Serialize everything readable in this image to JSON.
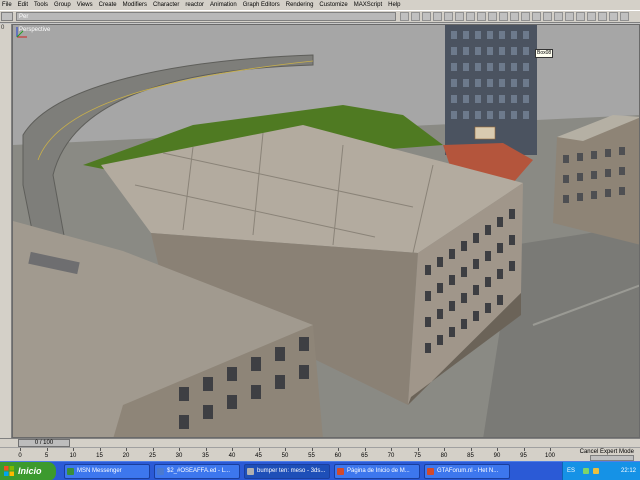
{
  "menu": {
    "items": [
      "File",
      "Edit",
      "Tools",
      "Group",
      "Views",
      "Create",
      "Modifiers",
      "Character",
      "reactor",
      "Animation",
      "Graph Editors",
      "Rendering",
      "Customize",
      "MAXScript",
      "Help"
    ]
  },
  "toolbar": {
    "view_label": "Per",
    "name_field": "Per"
  },
  "leftstrip": {
    "number": "0"
  },
  "viewport": {
    "label": "Perspective",
    "tooltip": "Box08"
  },
  "timeslider": {
    "label": "0 / 100",
    "progress": 0
  },
  "track": {
    "ticks": [
      "0",
      "5",
      "10",
      "15",
      "20",
      "25",
      "30",
      "35",
      "40",
      "45",
      "50",
      "55",
      "60",
      "65",
      "70",
      "75",
      "80",
      "85",
      "90",
      "95",
      "100"
    ],
    "status": "Cancel Expert Mode"
  },
  "taskbar": {
    "start": "Inicio",
    "tasks": [
      {
        "label": "MSN Messenger",
        "color": "#3a8f3a"
      },
      {
        "label": "$2_#OSEAFFA.ed - L...",
        "color": "#4a7ad0"
      },
      {
        "label": "bumper ten: meso - 3ds...",
        "color": "#b0b0b0"
      },
      {
        "label": "Página de Inicio de M...",
        "color": "#d34a2a"
      },
      {
        "label": "GTAForum.nl - Het N...",
        "color": "#d34a2a"
      }
    ],
    "tray": {
      "lang": "ES",
      "clock": "22:12"
    }
  },
  "colors": {
    "menu_bg": "#d4d0c8",
    "viewport_bg": "#a4a4a4",
    "taskbar_blue": "#2b5ad6",
    "start_green": "#3c9a2e",
    "tray_blue": "#1592e6"
  }
}
